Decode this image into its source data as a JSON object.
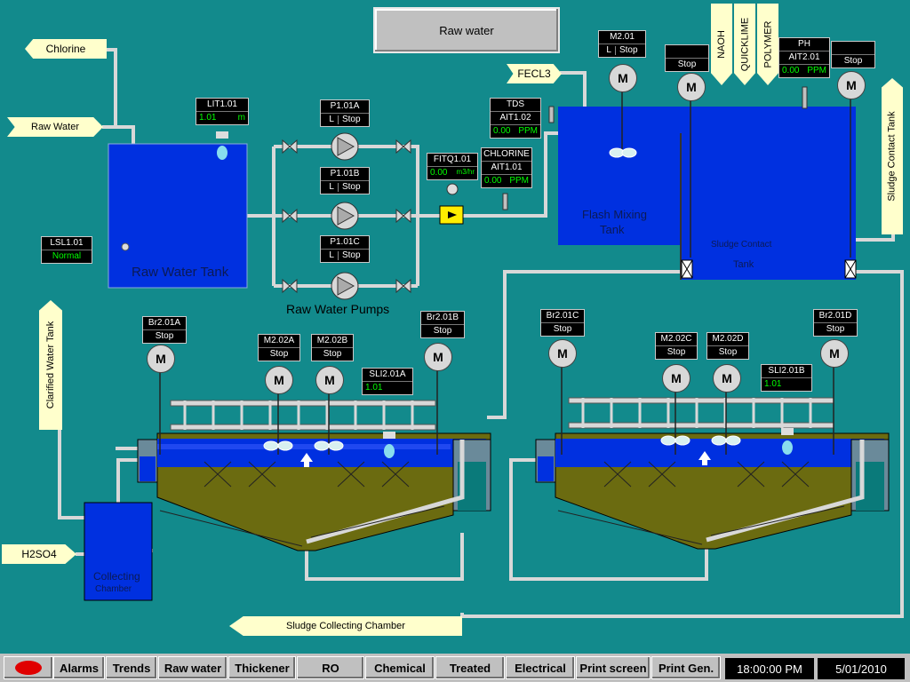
{
  "title": "Raw water",
  "chemicals": {
    "chlorine": "Chlorine",
    "raw_water": "Raw Water",
    "fecl3": "FECL3",
    "h2so4": "H2SO4",
    "naoh": "NAOH",
    "quicklime": "QUICKLIME",
    "polymer": "POLYMER",
    "sludge_contact_tank_out": "Sludge Contact Tank",
    "clarified_water_tank": "Clarified Water Tank",
    "sludge_collecting_chamber": "Sludge Collecting Chamber"
  },
  "tanks": {
    "raw_water_tank": "Raw Water Tank",
    "flash_mixing_tank_1": "Flash Mixing",
    "flash_mixing_tank_2": "Tank",
    "sludge_contact_1": "Sludge Contact",
    "sludge_contact_2": "Tank",
    "collecting_chamber_1": "Collecting",
    "collecting_chamber_2": "Chamber",
    "raw_water_pumps": "Raw Water Pumps"
  },
  "instruments": {
    "lit101": {
      "name": "LIT1.01",
      "value": "1.01",
      "unit": "m"
    },
    "lsl101": {
      "name": "LSL1.01",
      "value": "Normal"
    },
    "p101a": {
      "name": "P1.01A",
      "mode": "L",
      "status": "Stop"
    },
    "p101b": {
      "name": "P1.01B",
      "mode": "L",
      "status": "Stop"
    },
    "p101c": {
      "name": "P1.01C",
      "mode": "L",
      "status": "Stop"
    },
    "fitq101": {
      "name": "FITQ1.01",
      "value": "0.00",
      "unit": "m3/hr"
    },
    "tds": {
      "name": "TDS",
      "sub": "AIT1.02",
      "value": "0.00",
      "unit": "PPM"
    },
    "chlorine": {
      "name": "CHLORINE",
      "sub": "AIT1.01",
      "value": "0.00",
      "unit": "PPM"
    },
    "m201": {
      "name": "M2.01",
      "mode": "L",
      "status": "Stop"
    },
    "naoh_motor": {
      "status": "Stop"
    },
    "ph": {
      "name": "PH",
      "sub": "AIT2.01",
      "value": "0.00",
      "unit": "PPM"
    },
    "polymer_motor": {
      "status": "Stop"
    },
    "br201a": {
      "name": "Br2.01A",
      "status": "Stop"
    },
    "m202a": {
      "name": "M2.02A",
      "status": "Stop"
    },
    "m202b": {
      "name": "M2.02B",
      "status": "Stop"
    },
    "sli201a": {
      "name": "SLI2.01A",
      "value": "1.01"
    },
    "br201b": {
      "name": "Br2.01B",
      "status": "Stop"
    },
    "br201c": {
      "name": "Br2.01C",
      "status": "Stop"
    },
    "m202c": {
      "name": "M2.02C",
      "status": "Stop"
    },
    "m202d": {
      "name": "M2.02D",
      "status": "Stop"
    },
    "sli201b": {
      "name": "SLI2.01B",
      "value": "1.01"
    },
    "br201d": {
      "name": "Br2.01D",
      "status": "Stop"
    }
  },
  "motor_letter": "M",
  "nav": {
    "alarms": "Alarms",
    "trends": "Trends",
    "raw_water": "Raw water",
    "thickener": "Thickener",
    "ro": "RO",
    "chemical": "Chemical",
    "treated": "Treated",
    "electrical": "Electrical",
    "print_screen": "Print screen",
    "print_gen": "Print Gen."
  },
  "clock": {
    "time": "18:00:00 PM",
    "date": "5/01/2010"
  },
  "colors": {
    "background": "#128a8c",
    "tank": "#0030e0",
    "sludge": "#6b6b10",
    "alarm": "#e00000"
  }
}
